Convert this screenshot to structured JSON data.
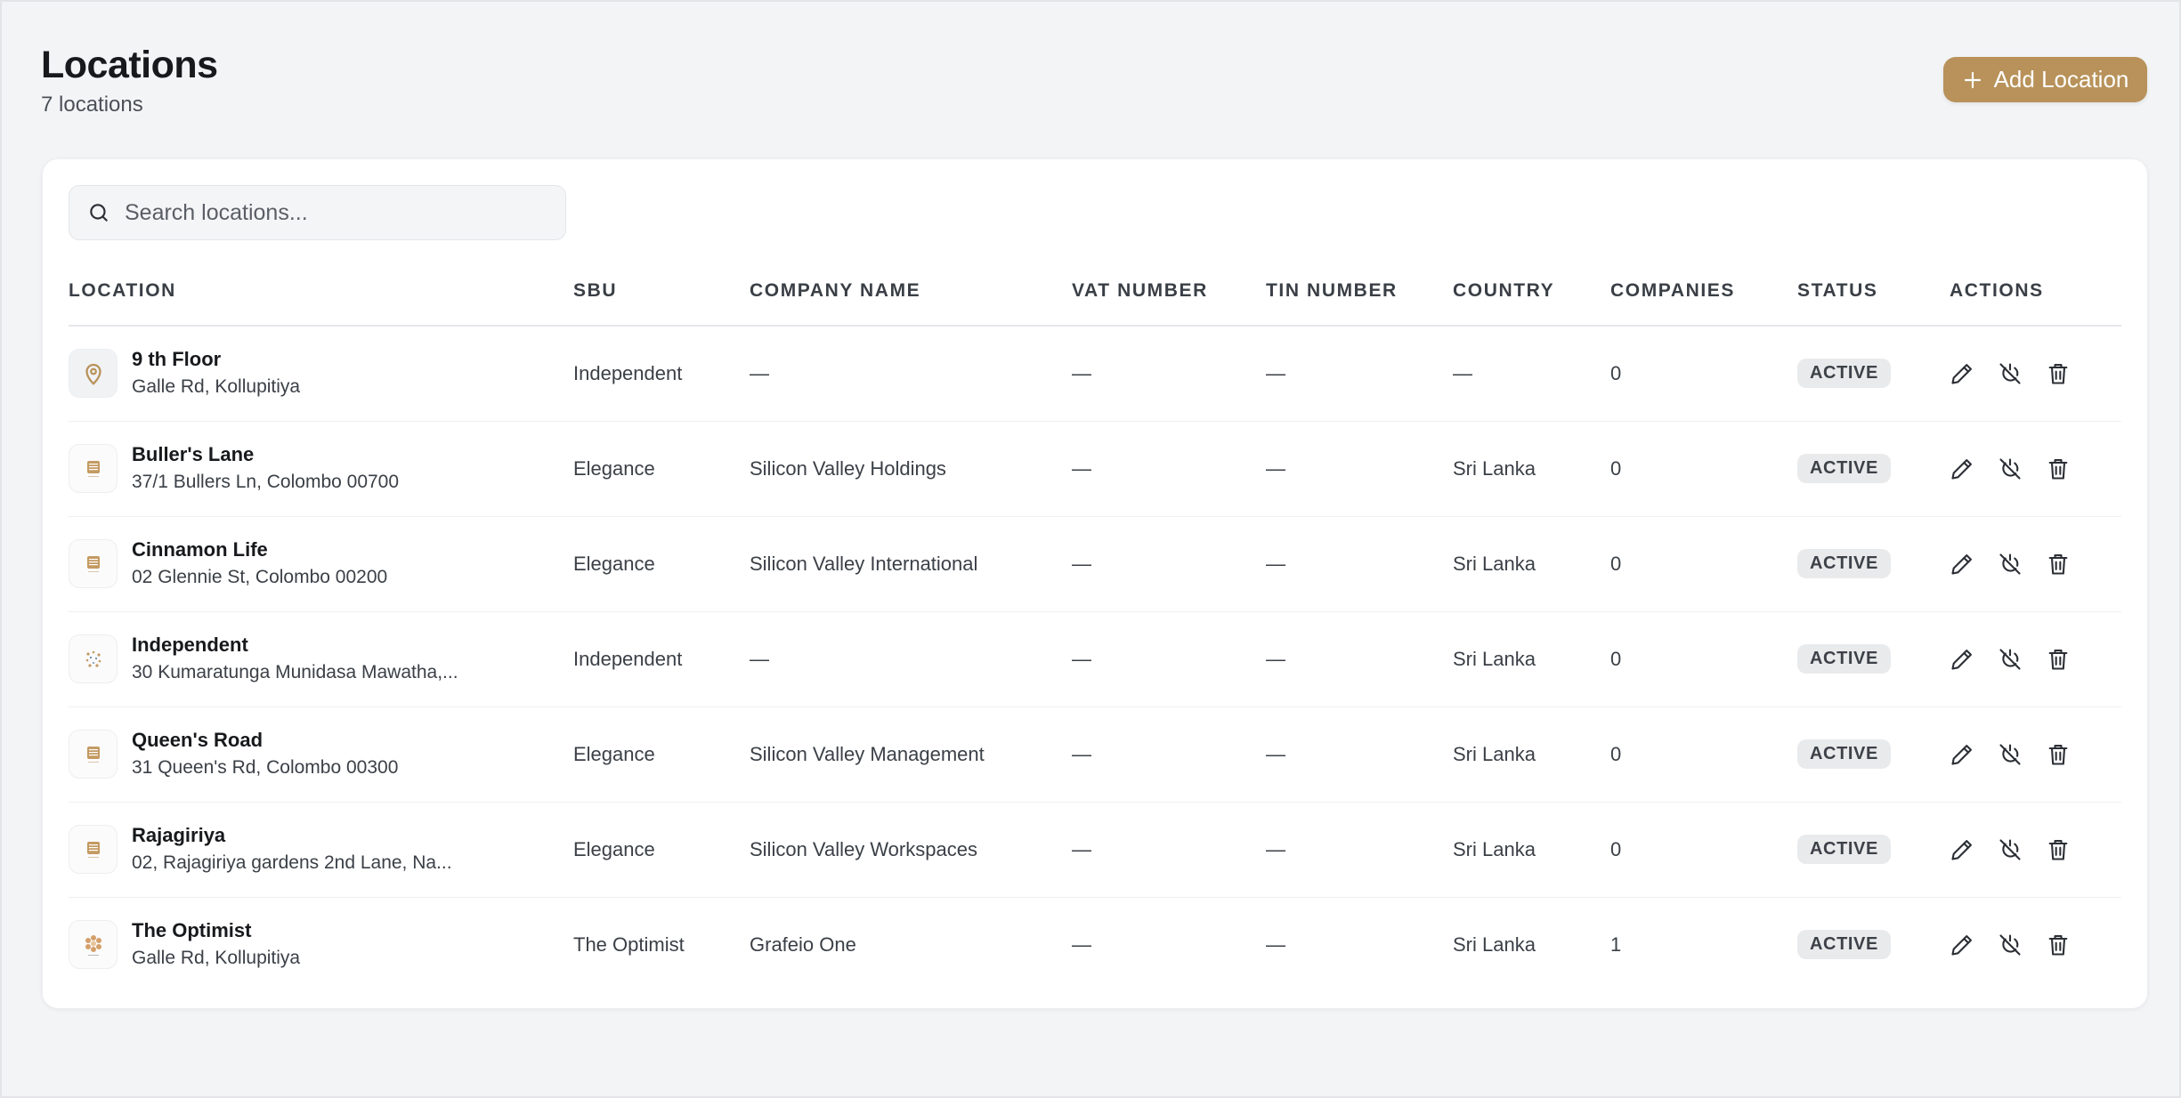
{
  "header": {
    "title": "Locations",
    "count_text": "7 locations",
    "add_button_label": "Add Location"
  },
  "colors": {
    "accent": "#b8925a",
    "background": "#f3f4f6",
    "badge_bg": "#e9eaec"
  },
  "search": {
    "placeholder": "Search locations..."
  },
  "table": {
    "columns": [
      "LOCATION",
      "SBU",
      "COMPANY NAME",
      "VAT NUMBER",
      "TIN NUMBER",
      "COUNTRY",
      "COMPANIES",
      "STATUS",
      "ACTIONS"
    ],
    "rows": [
      {
        "name": "9 th Floor",
        "address": "Galle Rd, Kollupitiya",
        "sbu": "Independent",
        "company": "—",
        "vat": "—",
        "tin": "—",
        "country": "—",
        "companies": "0",
        "status": "ACTIVE",
        "icon": "map-pin-icon"
      },
      {
        "name": "Buller's Lane",
        "address": "37/1 Bullers Ln, Colombo 00700",
        "sbu": "Elegance",
        "company": "Silicon Valley Holdings",
        "vat": "—",
        "tin": "—",
        "country": "Sri Lanka",
        "companies": "0",
        "status": "ACTIVE",
        "icon": "elegance-logo-icon"
      },
      {
        "name": "Cinnamon Life",
        "address": "02 Glennie St, Colombo 00200",
        "sbu": "Elegance",
        "company": "Silicon Valley International",
        "vat": "—",
        "tin": "—",
        "country": "Sri Lanka",
        "companies": "0",
        "status": "ACTIVE",
        "icon": "elegance-logo-icon"
      },
      {
        "name": "Independent",
        "address": "30 Kumaratunga Munidasa Mawatha,...",
        "sbu": "Independent",
        "company": "—",
        "vat": "—",
        "tin": "—",
        "country": "Sri Lanka",
        "companies": "0",
        "status": "ACTIVE",
        "icon": "independent-logo-icon"
      },
      {
        "name": "Queen's Road",
        "address": "31 Queen's Rd, Colombo 00300",
        "sbu": "Elegance",
        "company": "Silicon Valley Management",
        "vat": "—",
        "tin": "—",
        "country": "Sri Lanka",
        "companies": "0",
        "status": "ACTIVE",
        "icon": "elegance-logo-icon"
      },
      {
        "name": "Rajagiriya",
        "address": "02, Rajagiriya gardens 2nd Lane, Na...",
        "sbu": "Elegance",
        "company": "Silicon Valley Workspaces",
        "vat": "—",
        "tin": "—",
        "country": "Sri Lanka",
        "companies": "0",
        "status": "ACTIVE",
        "icon": "elegance-logo-icon"
      },
      {
        "name": "The Optimist",
        "address": "Galle Rd, Kollupitiya",
        "sbu": "The Optimist",
        "company": "Grafeio One",
        "vat": "—",
        "tin": "—",
        "country": "Sri Lanka",
        "companies": "1",
        "status": "ACTIVE",
        "icon": "optimist-logo-icon"
      }
    ]
  }
}
